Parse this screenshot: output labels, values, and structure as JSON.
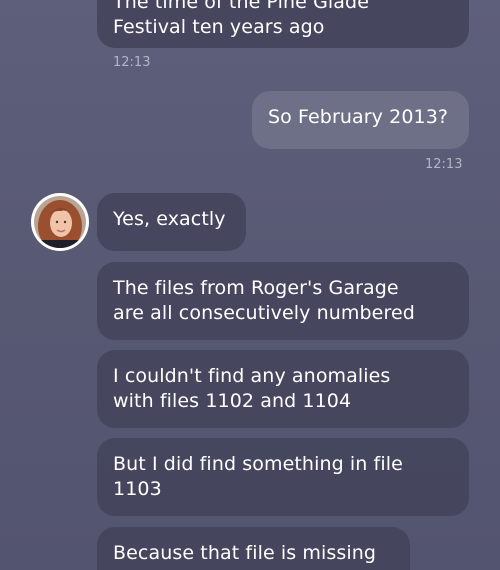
{
  "conversation": {
    "messages": [
      {
        "sender": "contact",
        "text": "The time of the Pine Glade\nFestival ten years ago"
      },
      {
        "sender": "me",
        "text": "So February 2013?"
      },
      {
        "sender": "contact",
        "text": "Yes, exactly"
      },
      {
        "sender": "contact",
        "text": "The files from Roger's Garage\nare all consecutively numbered"
      },
      {
        "sender": "contact",
        "text": "I couldn't find any anomalies\nwith files 1102 and 1104"
      },
      {
        "sender": "contact",
        "text": "But I did find something in file\n1103"
      },
      {
        "sender": "contact",
        "text": "Because that file is missing"
      }
    ],
    "timestamps": {
      "first": "12:13",
      "second": "12:13"
    }
  },
  "colors": {
    "background": "#5a5b76",
    "incoming_bubble": "#44455c",
    "outgoing_bubble": "#707189",
    "timestamp": "#b4b5c6"
  },
  "icons": {
    "avatar": "contact-avatar"
  }
}
